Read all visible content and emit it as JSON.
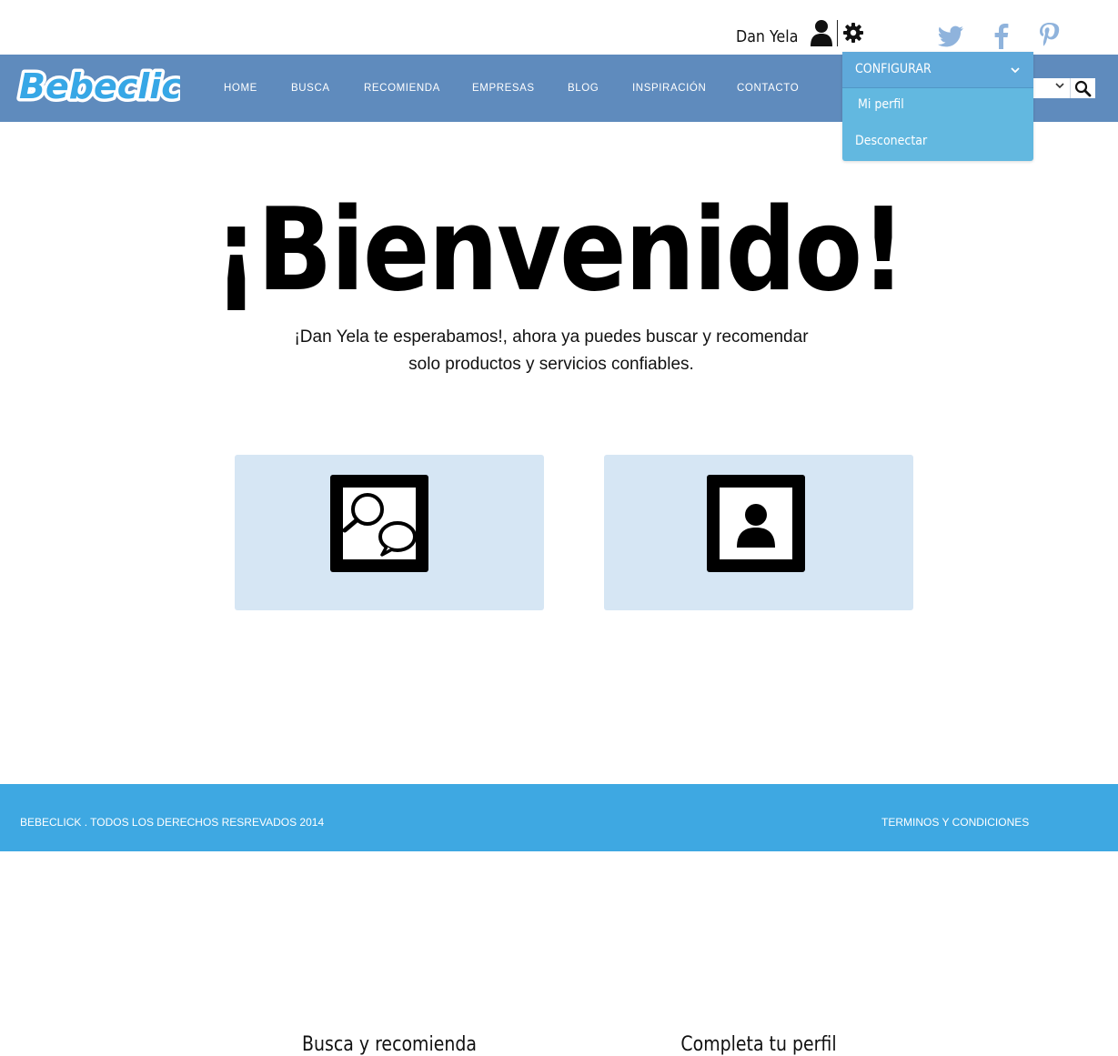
{
  "header": {
    "username": "Dan Yela",
    "icons": {
      "user": "user-icon",
      "settings": "gear-icon",
      "social": [
        "twitter-icon",
        "facebook-icon",
        "pinterest-icon"
      ]
    }
  },
  "brand": {
    "logo_text": "Bebeclick",
    "nav_color": "#5f8bbd",
    "footer_color": "#3ea8e2"
  },
  "nav": {
    "items": [
      "HOME",
      "BUSCA",
      "RECOMIENDA",
      "EMPRESAS",
      "BLOG",
      "INSPIRACIÓN",
      "CONTACTO"
    ]
  },
  "dropdown": {
    "title": "CONFIGURAR",
    "items": [
      "Mi perfil",
      "Desconectar"
    ]
  },
  "hero": {
    "title": "¡Bienvenido!",
    "subtitle_line1": "¡Dan Yela te esperabamos!, ahora ya puedes buscar y recomendar",
    "subtitle_line2": "solo productos y servicios confiables."
  },
  "cards": [
    {
      "label": "Busca y recomienda",
      "icon": "search-chat-icon"
    },
    {
      "label": "Completa tu perfil",
      "icon": "profile-icon"
    }
  ],
  "footer": {
    "copyright": "BEBECLICK . TODOS LOS DERECHOS RESREVADOS 2014",
    "terms": "TERMINOS Y CONDICIONES"
  }
}
